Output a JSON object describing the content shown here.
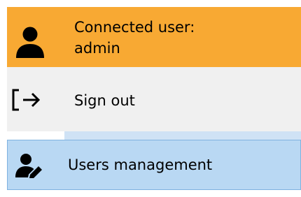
{
  "user_panel": {
    "label": "Connected user:",
    "username": "admin",
    "icon": "user-icon",
    "background": "#f8a933"
  },
  "menu": {
    "sign_out": {
      "label": "Sign out",
      "icon": "sign-out-icon",
      "background": "#f0f0f0"
    },
    "users_management": {
      "label": "Users management",
      "icon": "user-edit-icon",
      "background": "#b9d8f3",
      "selected": true
    }
  }
}
